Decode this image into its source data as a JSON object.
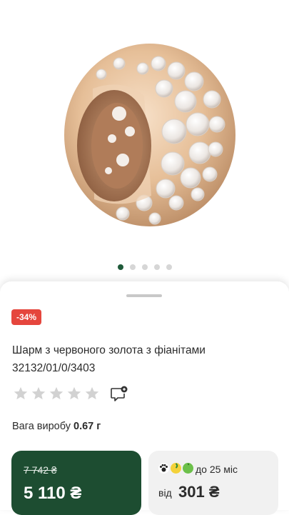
{
  "gallery": {
    "image_name": "red-gold-charm-with-cubic-zirconia",
    "slide_count": 5,
    "active_index": 0
  },
  "product": {
    "discount_badge": "-34%",
    "title_line1": "Шарм з червоного золота з фіанітами",
    "title_line2": "32132/01/0/3403",
    "rating_stars_filled": 0,
    "rating_stars_total": 5,
    "weight_label": "Вага виробу",
    "weight_value": "0.67 г"
  },
  "price": {
    "old": "7 742 ₴",
    "current": "5 110 ₴"
  },
  "credit": {
    "term": "до 25 міс",
    "from_label": "від",
    "amount": "301 ₴",
    "icons": [
      "paw-icon",
      "lemon-icon",
      "apple-icon"
    ]
  },
  "colors": {
    "brand_green": "#1d4d31",
    "badge_red": "#e5463d",
    "star_gray": "#d2d2d2",
    "credit_bg": "#f1f1f1"
  }
}
